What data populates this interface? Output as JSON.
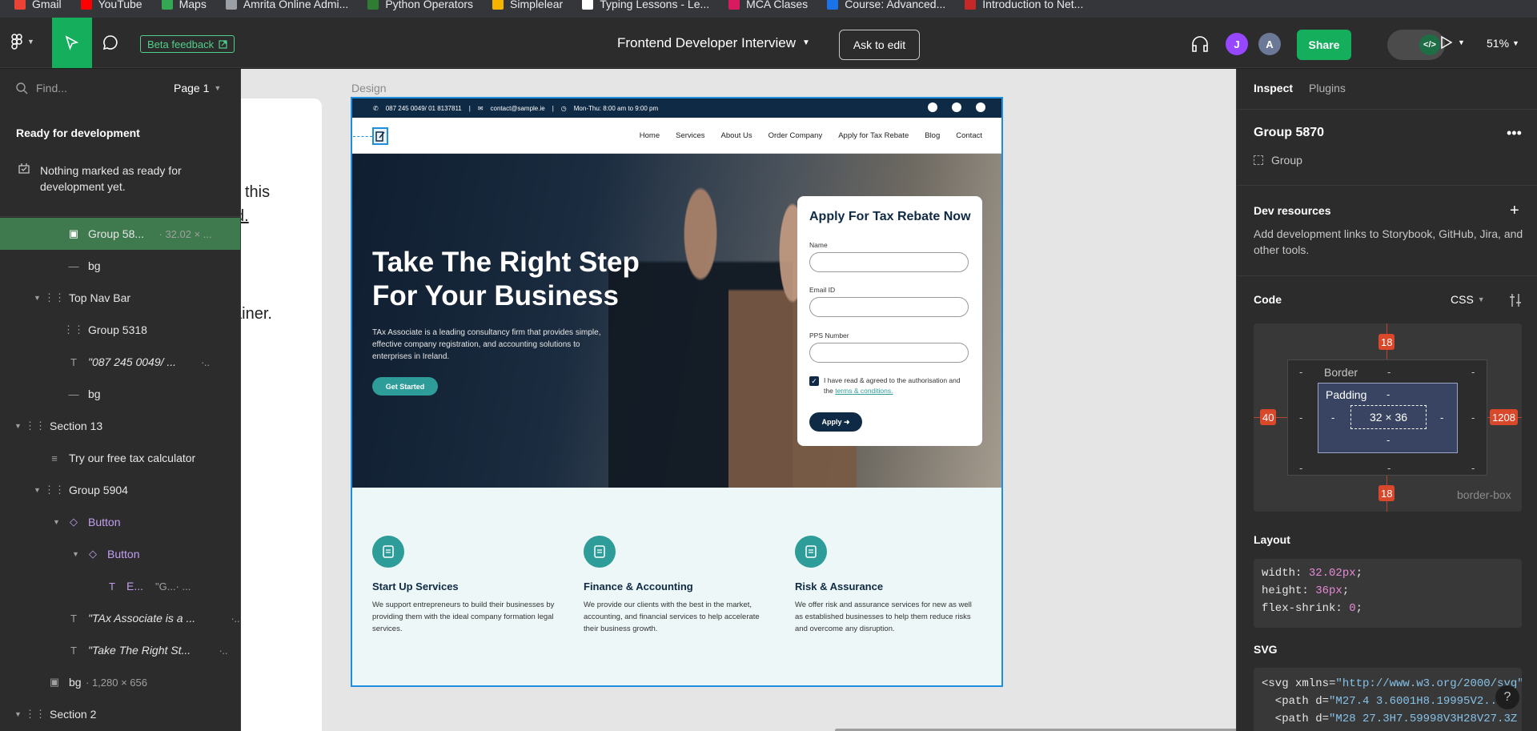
{
  "bookmarks": [
    {
      "label": "Gmail",
      "color": "#ea4335"
    },
    {
      "label": "YouTube",
      "color": "#ff0000"
    },
    {
      "label": "Maps",
      "color": "#34a853"
    },
    {
      "label": "Amrita Online Admi...",
      "color": "#9aa0a6"
    },
    {
      "label": "Python Operators",
      "color": "#2e7d32"
    },
    {
      "label": "Simplelear",
      "color": "#f4b400"
    },
    {
      "label": "Typing Lessons - Le...",
      "color": "#ffffff"
    },
    {
      "label": "MCA Clases",
      "color": "#d81b60"
    },
    {
      "label": "Course: Advanced...",
      "color": "#1a73e8"
    },
    {
      "label": "Introduction to Net...",
      "color": "#c62828"
    }
  ],
  "toolbar": {
    "beta_label": "Beta feedback",
    "file_title": "Frontend Developer Interview",
    "ask_edit": "Ask to edit",
    "avatars": [
      {
        "letter": "J",
        "color": "#9747ff"
      },
      {
        "letter": "A",
        "color": "#6b7896"
      }
    ],
    "share": "Share",
    "zoom": "51%"
  },
  "left_panel": {
    "find_placeholder": "Find...",
    "page": "Page 1",
    "ready_heading": "Ready for development",
    "ready_text": "Nothing marked as ready for development yet.",
    "layers": [
      {
        "label": "Group 58...",
        "meta": "· 32.02 × ...",
        "icon": "image-layer-icon",
        "caret": "",
        "indent": 3,
        "selected": true
      },
      {
        "label": "bg",
        "meta": "",
        "icon": "line-icon",
        "caret": "",
        "indent": 3
      },
      {
        "label": "Top Nav Bar",
        "meta": "",
        "icon": "frame-icon",
        "caret": "▼",
        "indent": 2
      },
      {
        "label": "Group 5318",
        "meta": "",
        "icon": "frame-icon",
        "caret": "",
        "indent": 3
      },
      {
        "label": "\"087 245 0049/ ...",
        "meta": "·..",
        "icon": "text-icon",
        "caret": "",
        "indent": 3,
        "italic": true
      },
      {
        "label": "bg",
        "meta": "",
        "icon": "line-icon",
        "caret": "",
        "indent": 3
      },
      {
        "label": "Section 13",
        "meta": "",
        "icon": "frame-icon",
        "caret": "▼",
        "indent": 1
      },
      {
        "label": "Try our free tax calculator",
        "meta": "",
        "icon": "paragraph-icon",
        "caret": "",
        "indent": 2
      },
      {
        "label": "Group 5904",
        "meta": "",
        "icon": "frame-icon",
        "caret": "▼",
        "indent": 2
      },
      {
        "label": "Button",
        "meta": "",
        "icon": "component-icon",
        "caret": "▼",
        "indent": 3,
        "component": true
      },
      {
        "label": "Button",
        "meta": "",
        "icon": "component-icon",
        "caret": "▼",
        "indent": 4,
        "component": true
      },
      {
        "label": "E...",
        "meta": "\"G...· ...",
        "icon": "text-icon",
        "caret": "",
        "indent": 5,
        "component": true
      },
      {
        "label": "\"TAx Associate is a ...",
        "meta": "·..",
        "icon": "text-icon",
        "caret": "",
        "indent": 3,
        "italic": true
      },
      {
        "label": "\"Take The Right St...",
        "meta": "·..",
        "icon": "text-icon",
        "caret": "",
        "indent": 3,
        "italic": true
      },
      {
        "label": "bg",
        "meta": "· 1,280 × 656",
        "icon": "image-layer-icon",
        "caret": "",
        "indent": 2
      },
      {
        "label": "Section 2",
        "meta": "",
        "icon": "frame-icon",
        "caret": "▼",
        "indent": 1
      }
    ]
  },
  "canvas": {
    "design_label": "Design",
    "ghost_lines": [
      "this",
      "d.",
      "ainer."
    ],
    "site": {
      "contact_phone": "087 245 0049/ 01 8137811",
      "contact_email": "contact@sample.ie",
      "contact_hours": "Mon-Thu: 8:00 am to 9:00 pm",
      "nav": [
        "Home",
        "Services",
        "About Us",
        "Order Company",
        "Apply for Tax Rebate",
        "Blog",
        "Contact"
      ],
      "hero_title": "Take The Right Step For Your Business",
      "hero_text": "TAx Associate is a leading consultancy firm that provides simple, effective company registration, and accounting solutions to enterprises in Ireland.",
      "hero_button": "Get Started",
      "form": {
        "title": "Apply For Tax Rebate Now",
        "name_label": "Name",
        "email_label": "Email ID",
        "pps_label": "PPS Number",
        "consent_text": "I have read & agreed to the authorisation and the",
        "consent_link": "terms & conditions.",
        "apply": "Apply ➜"
      },
      "services": [
        {
          "title": "Start Up Services",
          "text": "We support entrepreneurs to build their businesses by providing them with the ideal company formation legal services.",
          "icon": "receipt-icon"
        },
        {
          "title": "Finance & Accounting",
          "text": "We provide our clients with the best in the market, accounting, and financial services to help accelerate their business growth.",
          "icon": "calculator-icon"
        },
        {
          "title": "Risk & Assurance",
          "text": "We offer risk and assurance services for new as well as established businesses to help them reduce risks and overcome any disruption.",
          "icon": "shield-check-icon"
        }
      ]
    }
  },
  "right_panel": {
    "tabs": [
      "Inspect",
      "Plugins"
    ],
    "group_name": "Group 5870",
    "group_type": "Group",
    "dev_resources_heading": "Dev resources",
    "dev_resources_text": "Add development links to Storybook, GitHub, Jira, and other tools.",
    "code_heading": "Code",
    "code_lang": "CSS",
    "box_model": {
      "margin_top": "18",
      "margin_bottom": "18",
      "margin_left": "40",
      "margin_right": "1208",
      "border_label": "Border",
      "padding_label": "Padding",
      "content": "32 × 36",
      "sizing": "border-box",
      "dash": "-"
    },
    "layout_heading": "Layout",
    "layout_code": [
      {
        "prop": "width: ",
        "val": "32.02px",
        "end": ";"
      },
      {
        "prop": "height: ",
        "val": "36px",
        "end": ";"
      },
      {
        "prop": "flex-shrink: ",
        "val": "0",
        "end": ";"
      }
    ],
    "svg_heading": "SVG",
    "svg_code": [
      {
        "pre": "<svg xmlns=",
        "val": "\"http://www.w3.org/2000/svg\""
      },
      {
        "pre": "  <path d=",
        "val": "\"M27.4 3.6001H8.19995V2...01"
      },
      {
        "pre": "  <path d=",
        "val": "\"M28 27.3H7.59998V3H28V27.3Z"
      }
    ],
    "help": "?"
  }
}
